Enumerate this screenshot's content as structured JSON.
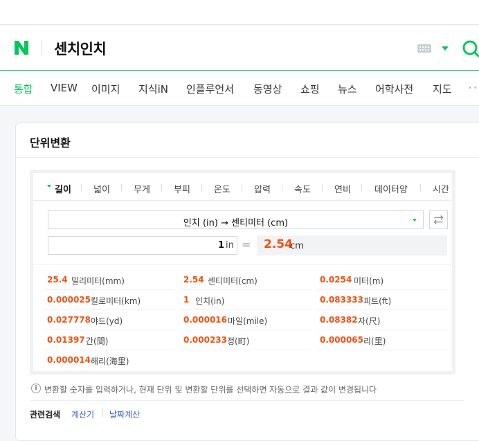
{
  "search": {
    "query": "센치인치",
    "logo_letter": "N"
  },
  "tabs": [
    {
      "label": "통합",
      "active": true
    },
    {
      "label": "VIEW"
    },
    {
      "label": "이미지"
    },
    {
      "label": "지식iN"
    },
    {
      "label": "인플루언서"
    },
    {
      "label": "동영상"
    },
    {
      "label": "쇼핑"
    },
    {
      "label": "뉴스"
    },
    {
      "label": "어학사전"
    },
    {
      "label": "지도"
    }
  ],
  "card": {
    "title": "단위변환"
  },
  "converter": {
    "categories": [
      "길이",
      "넓이",
      "무게",
      "부피",
      "온도",
      "압력",
      "속도",
      "연비",
      "데이터양",
      "시간"
    ],
    "active_category": "길이",
    "unit_pair": "인치 (in)  →  센티미터 (cm)",
    "input_value": "1",
    "input_unit": "in",
    "equals": "=",
    "result_value": "2.54",
    "result_unit": "cm"
  },
  "conversions": [
    {
      "value": "25.4",
      "unit": "밀리미터(mm)"
    },
    {
      "value": "2.54",
      "unit": "센티미터(cm)"
    },
    {
      "value": "0.0254",
      "unit": "미터(m)"
    },
    {
      "value": "0.000025",
      "unit": "킬로미터(km)"
    },
    {
      "value": "1",
      "unit": "인치(in)"
    },
    {
      "value": "0.083333",
      "unit": "피트(ft)"
    },
    {
      "value": "0.027778",
      "unit": "야드(yd)"
    },
    {
      "value": "0.000016",
      "unit": "마일(mile)"
    },
    {
      "value": "0.08382",
      "unit": "자(尺)"
    },
    {
      "value": "0.01397",
      "unit": "간(間)"
    },
    {
      "value": "0.000233",
      "unit": "정(町)"
    },
    {
      "value": "0.000065",
      "unit": "리(里)"
    },
    {
      "value": "0.000014",
      "unit": "해리(海里)"
    }
  ],
  "info": {
    "icon": "i",
    "text": "변환할 숫자를 입력하거나, 현재 단위 및 변환할 단위를 선택하면 자동으로 결과 값이 변경됩니다"
  },
  "related": {
    "label": "관련검색",
    "links": [
      "계산기",
      "날짜계산"
    ]
  },
  "colors": {
    "brand_green": "#03c75a",
    "result_orange": "#f54f0e",
    "link_blue": "#3a5fcd"
  }
}
